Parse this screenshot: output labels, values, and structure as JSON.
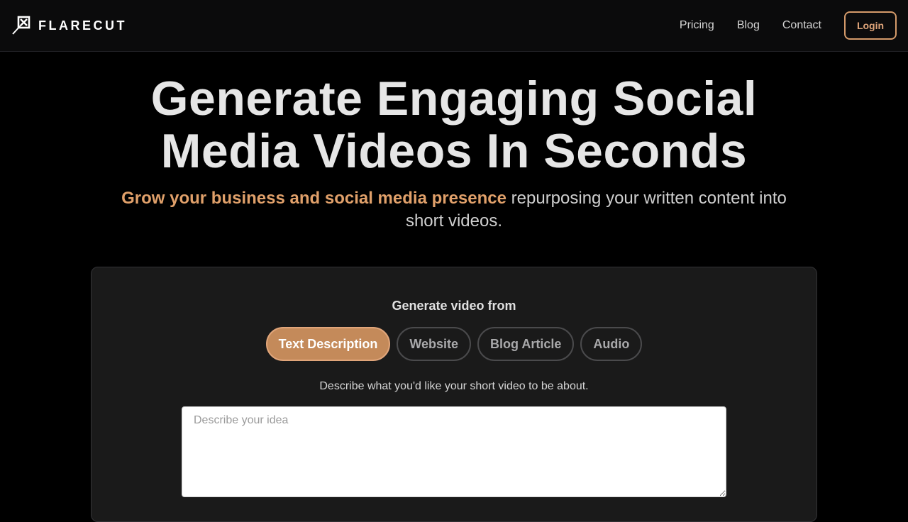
{
  "brand": {
    "name": "FLARECUT",
    "logo_icon": "flarecut-logo-icon"
  },
  "nav": {
    "links": [
      "Pricing",
      "Blog",
      "Contact"
    ],
    "login_label": "Login"
  },
  "hero": {
    "title_line1": "Generate Engaging Social",
    "title_line2": "Media Videos In Seconds",
    "subtitle_accent": "Grow your business and social media presence",
    "subtitle_rest": " repurposing your written content into short videos."
  },
  "generator": {
    "heading": "Generate video from",
    "tabs": [
      {
        "label": "Text Description",
        "active": true
      },
      {
        "label": "Website",
        "active": false
      },
      {
        "label": "Blog Article",
        "active": false
      },
      {
        "label": "Audio",
        "active": false
      }
    ],
    "description": "Describe what you'd like your short video to be about.",
    "input_placeholder": "Describe your idea",
    "input_value": ""
  },
  "colors": {
    "accent": "#c48a5a",
    "accent_text": "#e0a06a",
    "background": "#000000",
    "card": "#1a1a1a"
  }
}
